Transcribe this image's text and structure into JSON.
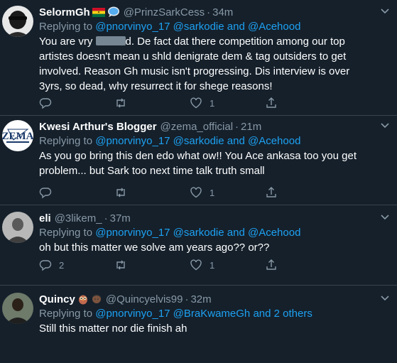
{
  "tweets": [
    {
      "name": "SelormGh",
      "badges": [
        "ghana-flag-emoji",
        "speech-bubble-emoji"
      ],
      "handle": "@PrinzSarkCess",
      "separator": "·",
      "time": "34m",
      "reply_prefix": "Replying to ",
      "reply_mentions": "@pnorvinyo_17 @sarkodie and @Acehood",
      "text_a": "You are vry ",
      "text_b": "d. De fact dat there competition among our top artistes doesn't mean u shld denigrate dem & tag outsiders to get involved. Reason Gh music isn't progressing. Dis interview is over 3yrs, so dead, why resurrect it for shege reasons!",
      "replies": "",
      "retweets": "",
      "likes": "1"
    },
    {
      "name": "Kwesi Arthur's Blogger",
      "handle": "@zema_official",
      "separator": "·",
      "time": "21m",
      "reply_prefix": "Replying to ",
      "reply_mentions": "@pnorvinyo_17 @sarkodie and @Acehood",
      "text": "As you go bring this den edo what ow!! You Ace ankasa too you get problem... but Sark too next time talk truth small",
      "replies": "",
      "retweets": "",
      "likes": "1"
    },
    {
      "name": "eli",
      "handle": "@3likem_",
      "separator": "·",
      "time": "37m",
      "reply_prefix": "Replying to ",
      "reply_mentions": "@pnorvinyo_17 @sarkodie and @Acehood",
      "text": "oh but this matter we solve am years ago?? or??",
      "replies": "2",
      "retweets": "",
      "likes": "1"
    },
    {
      "name": "Quincy",
      "badges": [
        "owl-emoji",
        "man-emoji"
      ],
      "handle": "@Quincyelvis99",
      "separator": "·",
      "time": "32m",
      "reply_prefix": "Replying to ",
      "reply_mentions": "@pnorvinyo_17 @BraKwameGh and 2 others",
      "text": "Still this matter nor die finish ah"
    }
  ],
  "colors": {
    "background": "#15202b",
    "divider": "#38444d",
    "muted": "#8899a6",
    "link": "#1da1f2"
  },
  "icons": [
    "reply-icon",
    "retweet-icon",
    "like-icon",
    "share-icon",
    "chevron-down-icon"
  ]
}
